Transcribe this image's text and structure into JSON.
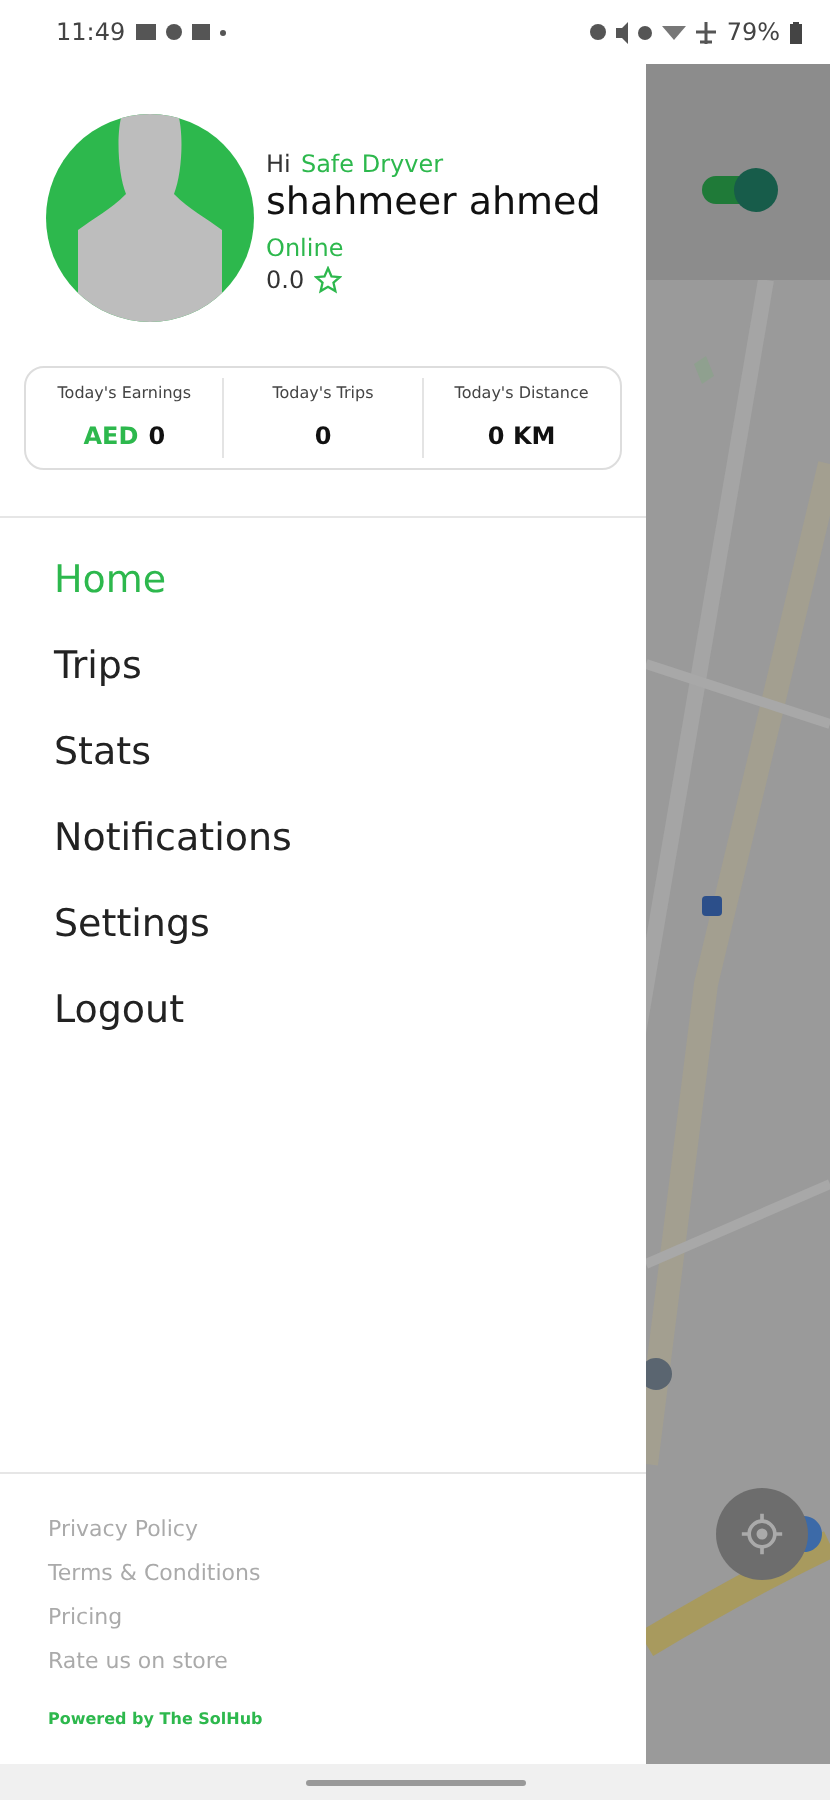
{
  "status_bar": {
    "time": "11:49",
    "battery": "79%"
  },
  "profile": {
    "greeting": "Hi",
    "app_name": "Safe Dryver",
    "name": "shahmeer ahmed",
    "status": "Online",
    "rating": "0.0"
  },
  "stats": [
    {
      "label": "Today's Earnings",
      "currency": "AED",
      "value": "0"
    },
    {
      "label": "Today's Trips",
      "value": "0"
    },
    {
      "label": "Today's Distance",
      "value": "0 KM"
    }
  ],
  "menu": [
    {
      "label": "Home",
      "selected": true
    },
    {
      "label": "Trips",
      "selected": false
    },
    {
      "label": "Stats",
      "selected": false
    },
    {
      "label": "Notifications",
      "selected": false
    },
    {
      "label": "Settings",
      "selected": false
    },
    {
      "label": "Logout",
      "selected": false
    }
  ],
  "footer_links": [
    "Privacy Policy",
    "Terms & Conditions",
    "Pricing",
    "Rate us on store"
  ],
  "powered_by": "Powered by The SolHub",
  "map": {
    "online_toggle": {
      "on": true
    }
  }
}
